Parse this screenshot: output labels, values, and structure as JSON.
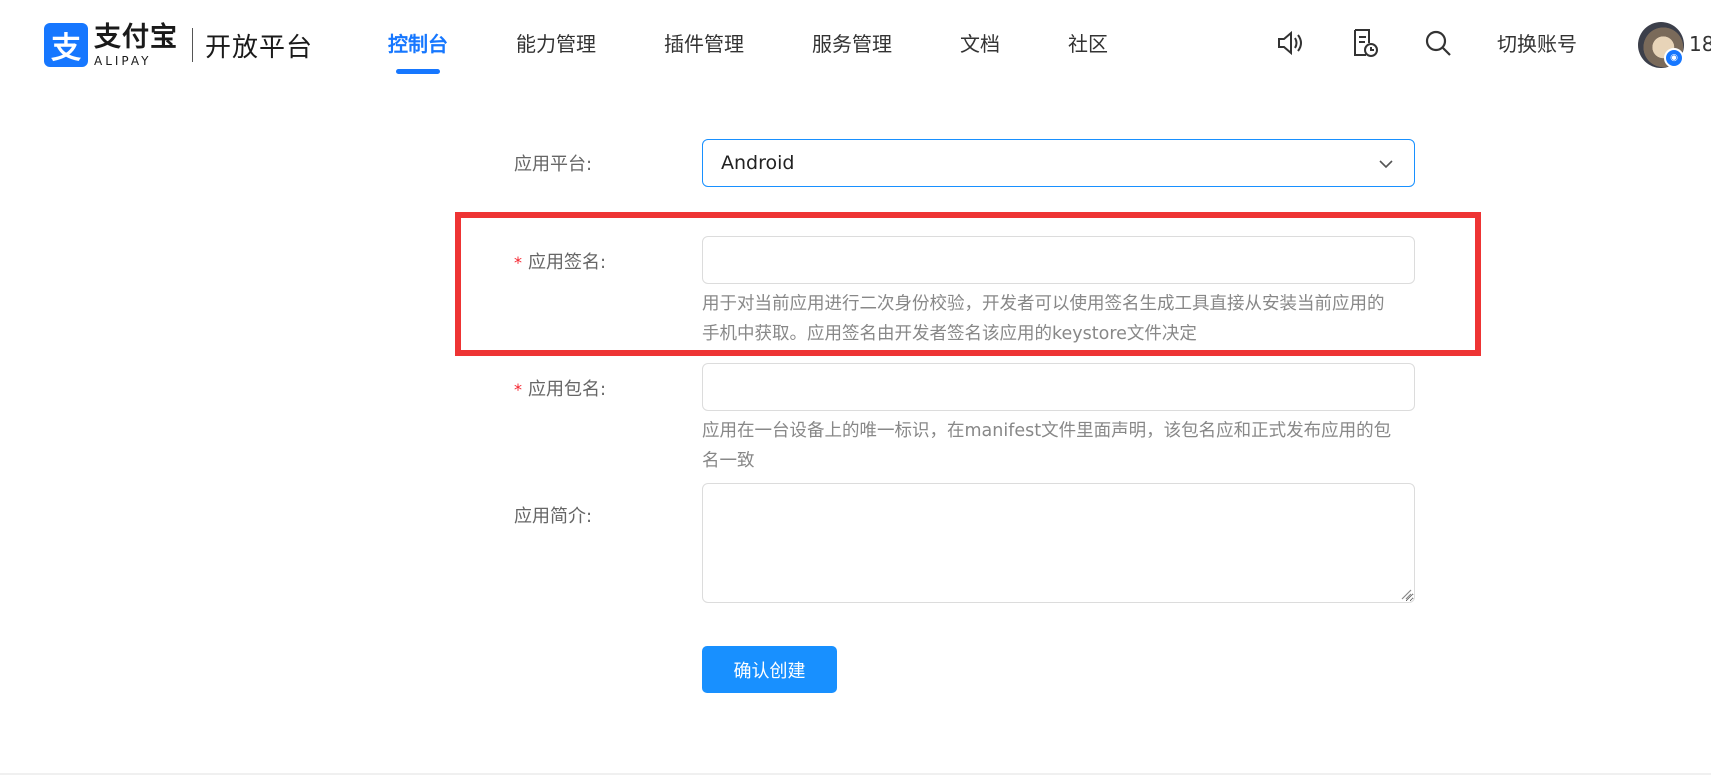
{
  "header": {
    "logo_cn": "支付宝",
    "logo_en": "ALIPAY",
    "logo_mark": "支",
    "platform": "开放平台",
    "nav": [
      {
        "label": "控制台",
        "active": true
      },
      {
        "label": "能力管理"
      },
      {
        "label": "插件管理"
      },
      {
        "label": "服务管理"
      },
      {
        "label": "文档"
      },
      {
        "label": "社区"
      }
    ],
    "tools": [
      "speaker-icon",
      "history-doc-icon",
      "search-icon"
    ],
    "switch_account": "切换账号",
    "user_text_partial": "18"
  },
  "form": {
    "platform_label": "应用平台:",
    "platform_value": "Android",
    "signature_label": "应用签名:",
    "signature_help_1": "用于对当前应用进行二次身份校验，开发者可以使用签名生成工具直接从安装当前应用的",
    "signature_help_2": "手机中获取。应用签名由开发者签名该应用的keystore文件决定",
    "package_label": "应用包名:",
    "package_help_1": "应用在一台设备上的唯一标识，在manifest文件里面声明，该包名应和正式发布应用的包",
    "package_help_2": "名一致",
    "intro_label": "应用简介:",
    "required_mark": "*",
    "submit_label": "确认创建"
  },
  "annotation": {
    "highlight_color": "#ee3434"
  },
  "colors": {
    "primary": "#1677ff",
    "button": "#1890ff",
    "required": "#f5222d"
  }
}
